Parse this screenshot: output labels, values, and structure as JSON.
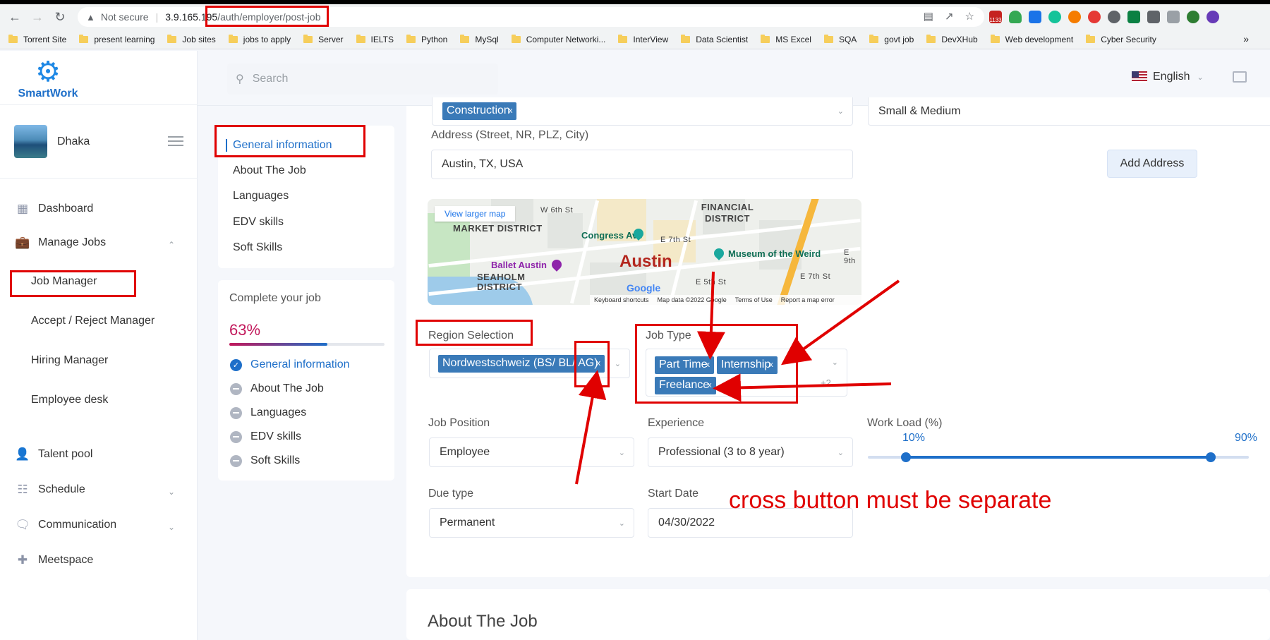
{
  "browser": {
    "security_label": "Not secure",
    "host": "3.9.165.195",
    "path": "/auth/employer/post-job",
    "extension_badge": "1133",
    "bookmarks": [
      "Torrent Site",
      "present learning",
      "Job sites",
      "jobs to apply",
      "Server",
      "IELTS",
      "Python",
      "MySql",
      "Computer Networki...",
      "InterView",
      "Data Scientist",
      "MS Excel",
      "SQA",
      "govt job",
      "DevXHub",
      "Web development",
      "Cyber Security"
    ],
    "more_bookmarks": "»"
  },
  "app": {
    "brand": "SmartWork",
    "search_placeholder": "Search",
    "language": "English",
    "user_name": "Dhaka"
  },
  "sidebar": {
    "dashboard": "Dashboard",
    "manage_jobs": "Manage Jobs",
    "job_manager": "Job Manager",
    "accept_reject": "Accept / Reject Manager",
    "hiring_manager": "Hiring Manager",
    "employee_desk": "Employee desk",
    "talent_pool": "Talent pool",
    "schedule": "Schedule",
    "communication": "Communication",
    "meetspace": "Meetspace"
  },
  "subnav": {
    "items": [
      "General information",
      "About The Job",
      "Languages",
      "EDV skills",
      "Soft Skills"
    ]
  },
  "progress": {
    "title": "Complete your job",
    "value_label": "63%",
    "value": 0.63,
    "items": [
      "General information",
      "About The Job",
      "Languages",
      "EDV skills",
      "Soft Skills"
    ]
  },
  "form": {
    "industry_tag": "Construction",
    "company_size": "Small & Medium",
    "address_label": "Address (Street, NR, PLZ, City)",
    "address_value": "Austin, TX, USA",
    "add_address": "Add Address",
    "region_label": "Region Selection",
    "region_tag": "Nordwestschweiz (BS/ BL/ AG)",
    "job_type_label": "Job Type",
    "job_type_tags": [
      "Part Time",
      "Internship",
      "Freelance"
    ],
    "job_type_more": "+2",
    "job_position_label": "Job Position",
    "job_position_value": "Employee",
    "experience_label": "Experience",
    "experience_value": "Professional (3 to 8 year)",
    "workload_label": "Work Load (%)",
    "workload_min_label": "10%",
    "workload_max_label": "90%",
    "workload_min": 10,
    "workload_max": 90,
    "due_type_label": "Due type",
    "due_type_value": "Permanent",
    "start_date_label": "Start Date",
    "start_date_value": "04/30/2022",
    "tag_remove_glyph": "x"
  },
  "map": {
    "view_larger": "View larger map",
    "city": "Austin",
    "districts": [
      "MARKET DISTRICT",
      "FINANCIAL DISTRICT",
      "SEAHOLM DISTRICT"
    ],
    "pois": [
      "Congress Ave",
      "Museum of the Weird",
      "Ballet Austin"
    ],
    "streets": [
      "W 6th St",
      "E 7th St",
      "E 5th St",
      "E 9th",
      "E 7th St"
    ],
    "google": "Google",
    "footer": [
      "Keyboard shortcuts",
      "Map data ©2022 Google",
      "Terms of Use",
      "Report a map error"
    ]
  },
  "section2_title": "About The Job",
  "annotation": "cross button must be separate",
  "colors": {
    "accent": "#1e6fc9",
    "tag_bg": "#3a7ab8",
    "annotation_red": "#e00000"
  }
}
